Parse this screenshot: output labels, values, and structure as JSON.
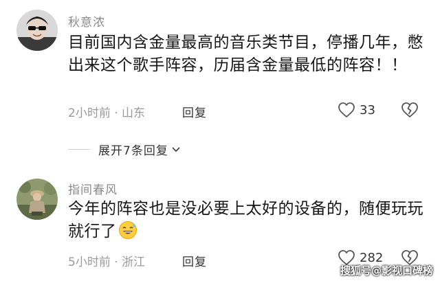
{
  "comments": [
    {
      "username": "秋意浓",
      "content": "目前国内含金量最高的音乐类节目，停播几年，憋出来这个歌手阵容，历届含金量最低的阵容！！",
      "time": "2小时前",
      "location": "山东",
      "meta_separator": " · ",
      "reply_label": "回复",
      "like_count": "33"
    },
    {
      "username": "指间春风",
      "content": "今年的阵容也是没必要上太好的设备的，随便玩玩就行了",
      "time": "5小时前",
      "location": "浙江",
      "meta_separator": " · ",
      "reply_label": "回复",
      "like_count": "282"
    }
  ],
  "expand_replies": {
    "label": "展开7条回复"
  },
  "watermark": "搜狐号@影视口碑榜",
  "icons": {
    "like": "heart-outline-icon",
    "dislike": "broken-heart-icon",
    "expand": "chevron-down-icon",
    "emoji": "sweat-smile-emoji-icon"
  },
  "colors": {
    "text": "#161616",
    "muted": "#9a9a9a",
    "username": "#8a8a8a"
  }
}
